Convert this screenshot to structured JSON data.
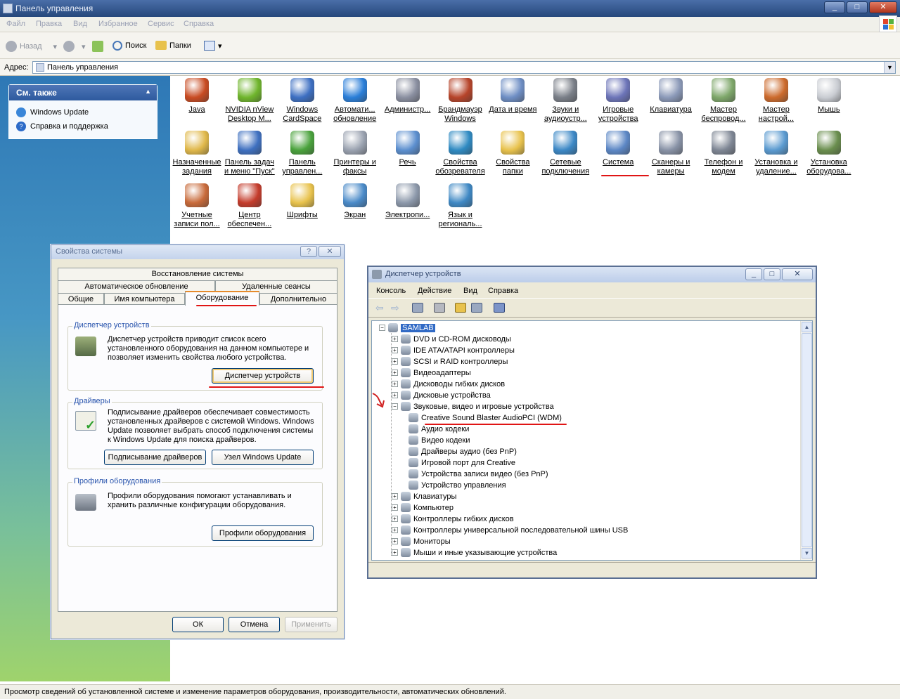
{
  "window": {
    "title": "Панель управления"
  },
  "menu": [
    "Файл",
    "Правка",
    "Вид",
    "Избранное",
    "Сервис",
    "Справка"
  ],
  "toolbar": {
    "back": "Назад",
    "search": "Поиск",
    "folders": "Папки"
  },
  "address": {
    "label": "Адрес:",
    "value": "Панель управления"
  },
  "see_also": {
    "title": "См. также",
    "items": [
      "Windows Update",
      "Справка и поддержка"
    ]
  },
  "icons": [
    {
      "l1": "Java",
      "l2": "",
      "color": "#c84b22"
    },
    {
      "l1": "NVIDIA nView",
      "l2": "Desktop M...",
      "color": "#6fb52c"
    },
    {
      "l1": "Windows",
      "l2": "CardSpace",
      "color": "#3d6fc2"
    },
    {
      "l1": "Автомати...",
      "l2": "обновление",
      "color": "#2a7ed8"
    },
    {
      "l1": "Администр...",
      "l2": "",
      "color": "#8a8fa0"
    },
    {
      "l1": "Брандмауэр",
      "l2": "Windows",
      "color": "#b6442a"
    },
    {
      "l1": "Дата и время",
      "l2": "",
      "color": "#6e8ec4"
    },
    {
      "l1": "Звуки и",
      "l2": "аудиоустр...",
      "color": "#7a7f88"
    },
    {
      "l1": "Игровые",
      "l2": "устройства",
      "color": "#6c74b8"
    },
    {
      "l1": "Клавиатура",
      "l2": "",
      "color": "#8b99b8"
    },
    {
      "l1": "Мастер",
      "l2": "беспровод...",
      "color": "#7ea76a"
    },
    {
      "l1": "Мастер",
      "l2": "настрой...",
      "color": "#cc6a2c"
    },
    {
      "l1": "Мышь",
      "l2": "",
      "color": "#c9ccd2"
    },
    {
      "l1": "Назначенные",
      "l2": "задания",
      "color": "#e0b84a"
    },
    {
      "l1": "Панель задач",
      "l2": "и меню \"Пуск\"",
      "color": "#3f70c0"
    },
    {
      "l1": "Панель",
      "l2": "управлен...",
      "color": "#4aa23c"
    },
    {
      "l1": "Принтеры и",
      "l2": "факсы",
      "color": "#9aa2b0"
    },
    {
      "l1": "Речь",
      "l2": "",
      "color": "#5c8fcf"
    },
    {
      "l1": "Свойства",
      "l2": "обозревателя",
      "color": "#2f8ac2"
    },
    {
      "l1": "Свойства",
      "l2": "папки",
      "color": "#e8c24c"
    },
    {
      "l1": "Сетевые",
      "l2": "подключения",
      "color": "#3c88c6"
    },
    {
      "l1": "Система",
      "l2": "",
      "color": "#5c87c5"
    },
    {
      "l1": "Сканеры и",
      "l2": "камеры",
      "color": "#8892a6"
    },
    {
      "l1": "Телефон и",
      "l2": "модем",
      "color": "#7e8694"
    },
    {
      "l1": "Установка и",
      "l2": "удаление...",
      "color": "#5a9ad0"
    },
    {
      "l1": "Установка",
      "l2": "оборудова...",
      "color": "#6a8e4e"
    },
    {
      "l1": "Учетные",
      "l2": "записи пол...",
      "color": "#c86a3a"
    },
    {
      "l1": "Центр",
      "l2": "обеспечен...",
      "color": "#c43c2c"
    },
    {
      "l1": "Шрифты",
      "l2": "",
      "color": "#e8c24c"
    },
    {
      "l1": "Экран",
      "l2": "",
      "color": "#4a8ac8"
    },
    {
      "l1": "Электропи...",
      "l2": "",
      "color": "#8c98aa"
    },
    {
      "l1": "Язык и",
      "l2": "региональ...",
      "color": "#3e88c4"
    }
  ],
  "status": "Просмотр сведений об установленной системе и изменение параметров оборудования, производительности, автоматических обновлений.",
  "props": {
    "title": "Свойства системы",
    "tabs_row1": [
      "Восстановление системы"
    ],
    "tabs_row2": [
      "Автоматическое обновление",
      "Удаленные сеансы"
    ],
    "tabs_row3": [
      "Общие",
      "Имя компьютера",
      "Оборудование",
      "Дополнительно"
    ],
    "devmgr_group": {
      "title": "Диспетчер устройств",
      "text1": "Диспетчер устройств приводит список всего",
      "text2": "установленного оборудования на данном компьютере и",
      "text3": "позволяет изменить свойства любого устройства.",
      "button": "Диспетчер устройств"
    },
    "drivers_group": {
      "title": "Драйверы",
      "text1": "Подписывание драйверов обеспечивает совместимость",
      "text2": "установленных драйверов с системой Windows.  Windows",
      "text3": "Update позволяет выбрать способ подключения системы",
      "text4": "к Windows Update для поиска драйверов.",
      "button1": "Подписывание драйверов",
      "button2": "Узел Windows Update"
    },
    "profiles_group": {
      "title": "Профили оборудования",
      "text1": "Профили оборудования помогают устанавливать и",
      "text2": "хранить различные конфигурации оборудования.",
      "button": "Профили оборудования"
    },
    "ok": "ОК",
    "cancel": "Отмена",
    "apply": "Применить",
    "help": "?"
  },
  "devmgr": {
    "title": "Диспетчер устройств",
    "menu": [
      "Консоль",
      "Действие",
      "Вид",
      "Справка"
    ],
    "tree": [
      {
        "label": "SAMLAB",
        "level": 0,
        "toggle": "−"
      },
      {
        "label": "DVD и CD-ROM дисководы",
        "level": 1,
        "toggle": "+"
      },
      {
        "label": "IDE ATA/ATAPI контроллеры",
        "level": 1,
        "toggle": "+"
      },
      {
        "label": "SCSI и RAID контроллеры",
        "level": 1,
        "toggle": "+"
      },
      {
        "label": "Видеоадаптеры",
        "level": 1,
        "toggle": "+"
      },
      {
        "label": "Дисководы гибких дисков",
        "level": 1,
        "toggle": "+"
      },
      {
        "label": "Дисковые устройства",
        "level": 1,
        "toggle": "+"
      },
      {
        "label": "Звуковые, видео и игровые устройства",
        "level": 1,
        "toggle": "−"
      },
      {
        "label": "Creative Sound Blaster AudioPCI (WDM)",
        "level": 2,
        "toggle": ""
      },
      {
        "label": "Аудио кодеки",
        "level": 2,
        "toggle": ""
      },
      {
        "label": "Видео кодеки",
        "level": 2,
        "toggle": ""
      },
      {
        "label": "Драйверы аудио (без PnP)",
        "level": 2,
        "toggle": ""
      },
      {
        "label": "Игровой порт для Creative",
        "level": 2,
        "toggle": ""
      },
      {
        "label": "Устройства записи видео (без PnP)",
        "level": 2,
        "toggle": ""
      },
      {
        "label": "Устройство управления",
        "level": 2,
        "toggle": ""
      },
      {
        "label": "Клавиатуры",
        "level": 1,
        "toggle": "+"
      },
      {
        "label": "Компьютер",
        "level": 1,
        "toggle": "+"
      },
      {
        "label": "Контроллеры гибких дисков",
        "level": 1,
        "toggle": "+"
      },
      {
        "label": "Контроллеры универсальной последовательной шины USB",
        "level": 1,
        "toggle": "+"
      },
      {
        "label": "Мониторы",
        "level": 1,
        "toggle": "+"
      },
      {
        "label": "Мыши и иные указывающие устройства",
        "level": 1,
        "toggle": "+"
      }
    ]
  },
  "colors": {
    "accent": "#e01515",
    "title_blue": "#2a55ad"
  }
}
